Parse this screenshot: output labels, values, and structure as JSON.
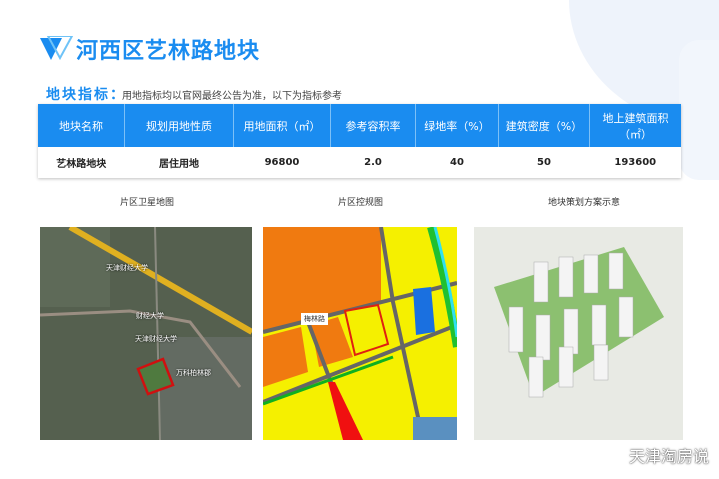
{
  "title": "河西区艺林路地块",
  "section": {
    "label": "地块指标：",
    "note": "用地指标均以官网最终公告为准，以下为指标参考"
  },
  "table": {
    "headers": [
      "地块名称",
      "规划用地性质",
      "用地面积（㎡）",
      "参考容积率",
      "绿地率（%）",
      "建筑密度（%）",
      "地上建筑面积（㎡）"
    ],
    "rows": [
      [
        "艺林路地块",
        "居住用地",
        "96800",
        "2.0",
        "40",
        "50",
        "193600"
      ]
    ]
  },
  "captions": [
    "片区卫星地图",
    "片区控规图",
    "地块策划方案示意"
  ],
  "map_labels": [
    "天津财经大学",
    "财经大学",
    "万科柏林郡",
    "天津财经大学",
    "梅林路"
  ],
  "watermark": "天津淘房说",
  "colors": {
    "accent": "#1a8cf0"
  }
}
